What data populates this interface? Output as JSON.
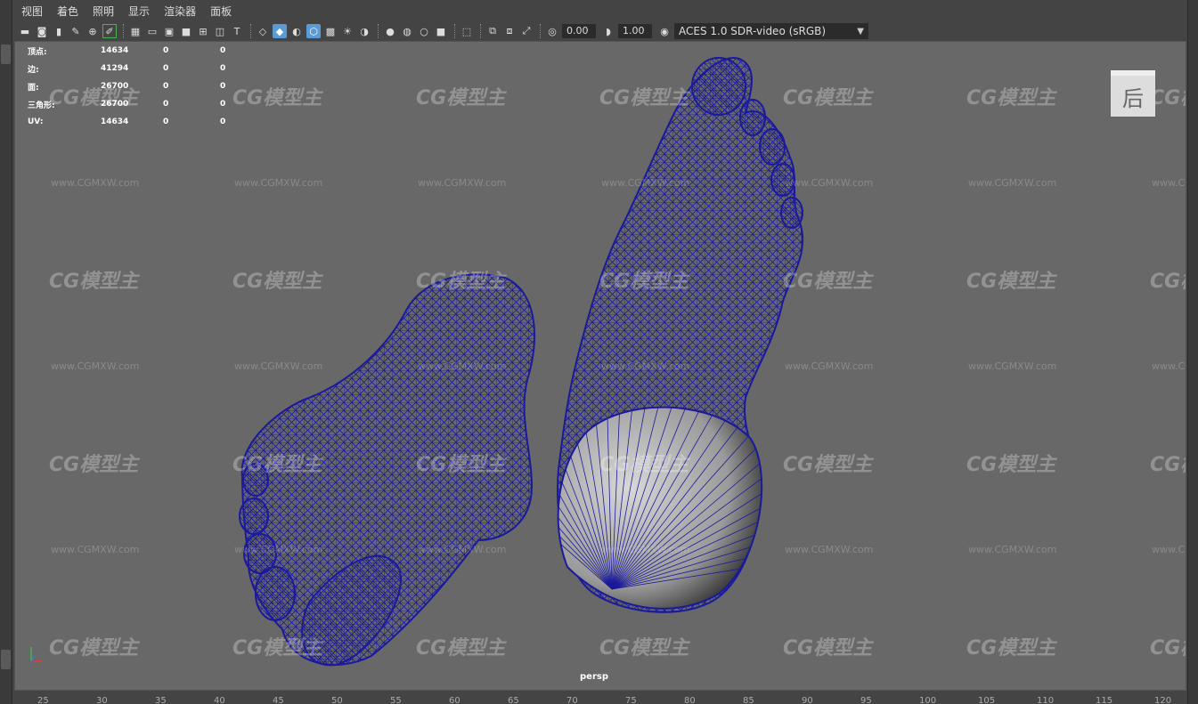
{
  "menu": [
    "视图",
    "着色",
    "照明",
    "显示",
    "渲染器",
    "面板"
  ],
  "toolbar": {
    "exposure_value": "0.00",
    "gamma_value": "1.00",
    "color_space": "ACES 1.0 SDR-video (sRGB)"
  },
  "hud": [
    {
      "label": "顶点:",
      "v1": "14634",
      "v2": "0",
      "v3": "0"
    },
    {
      "label": "边:",
      "v1": "41294",
      "v2": "0",
      "v3": "0"
    },
    {
      "label": "面:",
      "v1": "26700",
      "v2": "0",
      "v3": "0"
    },
    {
      "label": "三角形:",
      "v1": "26700",
      "v2": "0",
      "v3": "0"
    },
    {
      "label": "UV:",
      "v1": "14634",
      "v2": "0",
      "v3": "0"
    }
  ],
  "camera_label": "persp",
  "view_cube_label": "后",
  "watermark": {
    "logo": "CG模型主",
    "url": "www.CGMXW.com"
  },
  "ruler_ticks": [
    "25",
    "30",
    "35",
    "40",
    "45",
    "50",
    "55",
    "60",
    "65",
    "70",
    "75",
    "80",
    "85",
    "90",
    "95",
    "100",
    "105",
    "110",
    "115",
    "120"
  ],
  "colors": {
    "wireframe": "#1a1a9a",
    "viewport_bg": "#686868",
    "accent": "#5b9bd5"
  }
}
